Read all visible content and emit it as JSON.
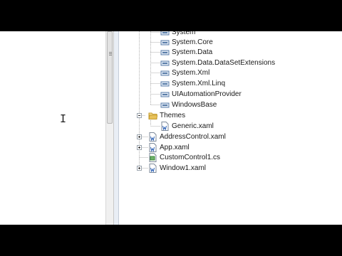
{
  "references": [
    {
      "label": "System"
    },
    {
      "label": "System.Core"
    },
    {
      "label": "System.Data"
    },
    {
      "label": "System.Data.DataSetExtensions"
    },
    {
      "label": "System.Xml"
    },
    {
      "label": "System.Xml.Linq"
    },
    {
      "label": "UIAutomationProvider"
    },
    {
      "label": "WindowsBase"
    }
  ],
  "themes_folder": {
    "label": "Themes",
    "expanded": true,
    "icon": "folder-open-icon"
  },
  "themes_children": [
    {
      "label": "Generic.xaml",
      "icon": "xaml-file-icon"
    }
  ],
  "project_files": [
    {
      "label": "AddressControl.xaml",
      "icon": "xaml-file-icon",
      "expander": true
    },
    {
      "label": "App.xaml",
      "icon": "xaml-file-icon",
      "expander": true
    },
    {
      "label": "CustomControl1.cs",
      "icon": "cs-file-icon",
      "expander": false
    },
    {
      "label": "Window1.xaml",
      "icon": "xaml-file-icon",
      "expander": true
    }
  ],
  "colors": {
    "screen_bg": "#ffffff",
    "letterbox": "#000000",
    "reference_icon": "#5a7da8",
    "folder": "#e8c25a"
  }
}
